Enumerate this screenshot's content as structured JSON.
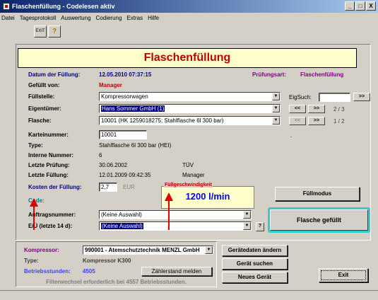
{
  "window": {
    "title": "Flaschenfüllung - Codelesen aktiv",
    "min": "_",
    "max": "□",
    "close": "X"
  },
  "menu": [
    "Datei",
    "Tagesprotokoll",
    "Auswertung",
    "Codierung",
    "Extras",
    "Hilfe"
  ],
  "toolbar": {
    "exit_label": "EXIT",
    "help_label": "?"
  },
  "header": {
    "title": "Flaschenfüllung"
  },
  "form": {
    "datum_label": "Datum der Füllung:",
    "datum_value": "12.05.2010  07:37:15",
    "pruefungsart_label": "Prüfungsart:",
    "pruefungsart_value": "Flaschenfüllung",
    "gefuellt_label": "Gefüllt von:",
    "gefuellt_value": "Manager",
    "fuellstelle_label": "Füllstelle:",
    "fuellstelle_value": "Kompressorwagen",
    "eigentuemer_label": "Eigentümer:",
    "eigentuemer_value": "Hans Sommer GmbH  (1)",
    "flasche_label": "Flasche:",
    "flasche_value": "10001  (HK 1259018275; Stahlflasche 6l 300 bar)",
    "karteinummer_label": "Karteinummer:",
    "karteinummer_value": "10001",
    "type_label": "Type:",
    "type_value": "Stahlflasche 6l 300 bar (HEI)",
    "interne_label": "Interne Nummer:",
    "interne_value": "6",
    "letzte_pruefung_label": "Letzte Prüfung:",
    "letzte_pruefung_value": "30.06.2002",
    "letzte_pruefung_org": "TÜV",
    "letzte_fuellung_label": "Letzte Füllung:",
    "letzte_fuellung_value": "12.01.2009 09:42:35",
    "letzte_fuellung_user": "Manager",
    "kosten_label": "Kosten der Füllung:",
    "kosten_value": "2,7",
    "kosten_unit": "EUR",
    "code_label": "Code:",
    "auftrag_label": "Auftragsnummer:",
    "auftrag_value": "(Keine Auswahl)",
    "eu_label": "E/Ü (letzte 14 d):",
    "eu_value": "(Keine Auswahl)",
    "eu_help": "?",
    "dot": "."
  },
  "search": {
    "eigsuch_label": "EigSuch:",
    "eigsuch_value": "",
    "go_label": ">>",
    "prev_label": "<<",
    "next_label": ">>",
    "eig_count": "2 / 3",
    "flasche_count": "1 / 2"
  },
  "fill_speed": {
    "label": "Füllgeschwindigkeit",
    "value": "1200 l/min"
  },
  "buttons": {
    "fuellmodus": "Füllmodus",
    "flasche_gefuellt": "Flasche gefüllt",
    "geraetedaten": "Gerätedaten ändern",
    "geraet_suchen": "Gerät suchen",
    "neues_geraet": "Neues Gerät",
    "exit": "Exit",
    "zaehlerstand": "Zählerstand melden"
  },
  "compressor": {
    "label": "Kompressor:",
    "value": "990001 - Atemschutztechnik MENZL GmbH",
    "type_label": "Type:",
    "type_value": "Kompressor K300",
    "betrieb_label": "Betriebsstunden:",
    "betrieb_value": "4505",
    "filter_note": "Filterwechsel erforderlich bei 4557 Betriebsstunden."
  },
  "colors": {
    "accent_cyan": "#33cccc",
    "label_navy": "#000080",
    "label_red": "#c00000",
    "arrow_red": "#e00000"
  }
}
